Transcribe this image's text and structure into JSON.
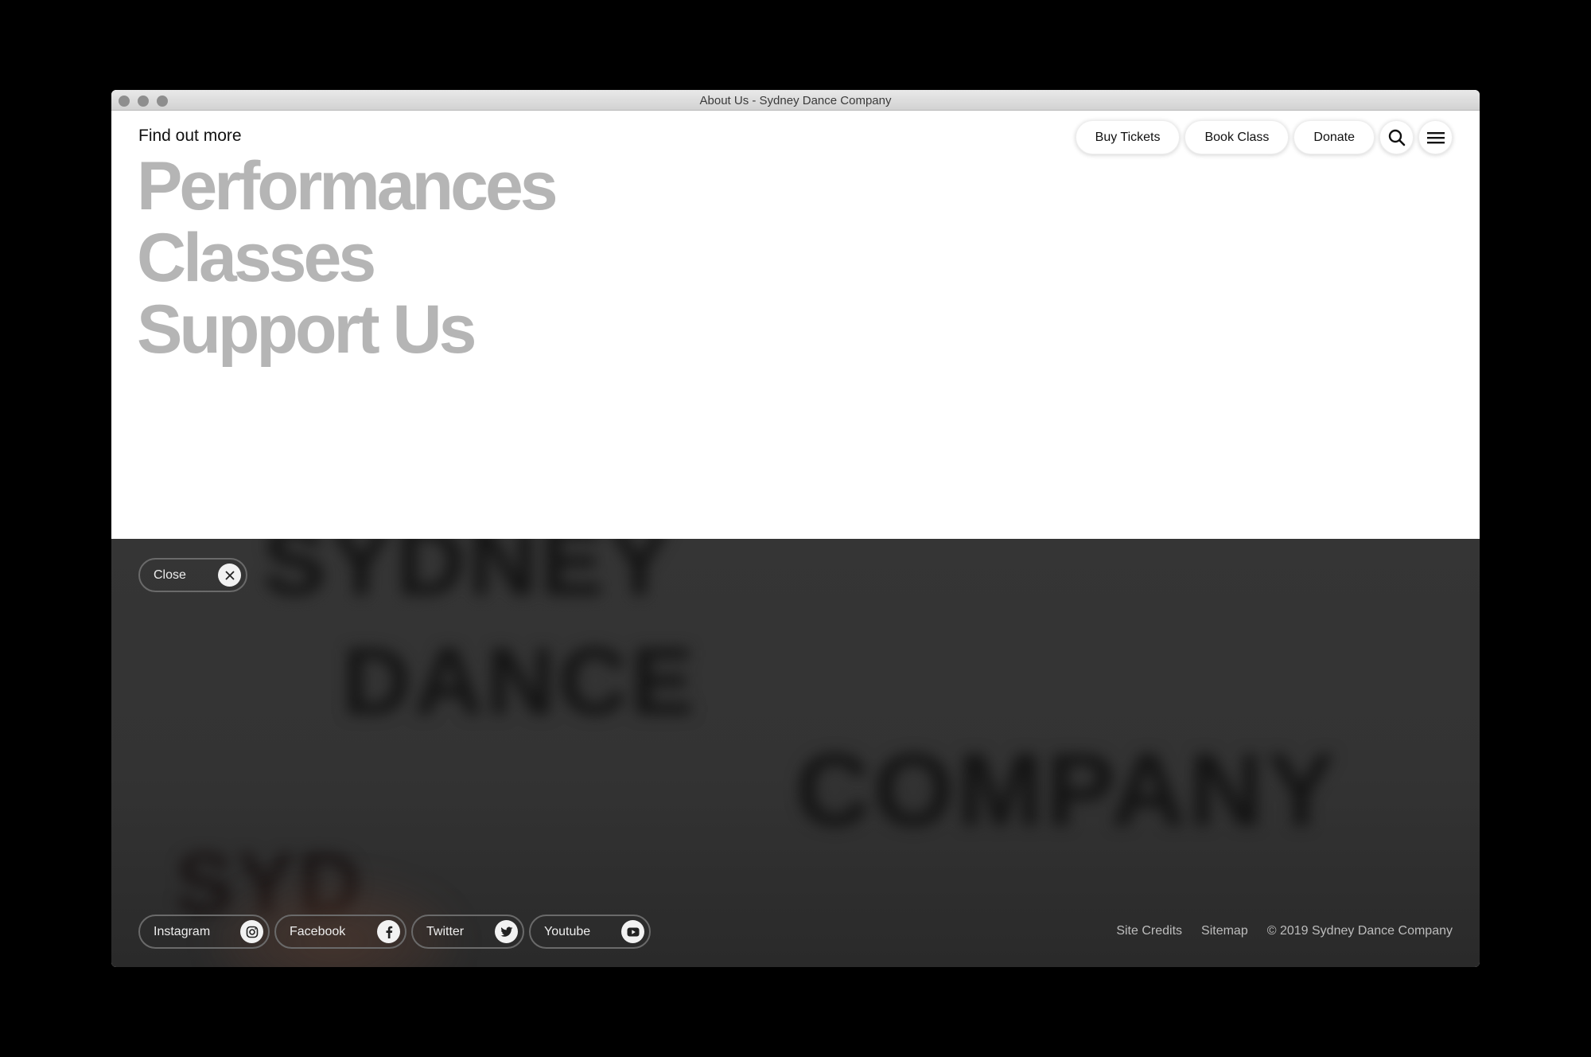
{
  "window": {
    "title": "About Us - Sydney Dance Company"
  },
  "menu": {
    "find_out_more": "Find out more",
    "links": [
      "Performances",
      "Classes",
      "Support Us"
    ]
  },
  "header": {
    "buy_tickets": "Buy Tickets",
    "book_class": "Book Class",
    "donate": "Donate",
    "search_icon": "search-icon",
    "menu_icon": "hamburger-menu-icon"
  },
  "close": {
    "label": "Close",
    "icon": "close-icon"
  },
  "background": {
    "words": [
      "SYDNEY",
      "DANCE",
      "COMPANY",
      "SYD"
    ]
  },
  "socials": [
    {
      "label": "Instagram",
      "icon": "instagram-icon"
    },
    {
      "label": "Facebook",
      "icon": "facebook-icon"
    },
    {
      "label": "Twitter",
      "icon": "twitter-icon"
    },
    {
      "label": "Youtube",
      "icon": "youtube-icon"
    }
  ],
  "footer": {
    "site_credits": "Site Credits",
    "sitemap": "Sitemap",
    "copyright": "© 2019 Sydney Dance Company"
  },
  "colors": {
    "menu_link": "#b5b5b5",
    "dark_bg": "#333333",
    "page_bg": "#ffffff"
  }
}
